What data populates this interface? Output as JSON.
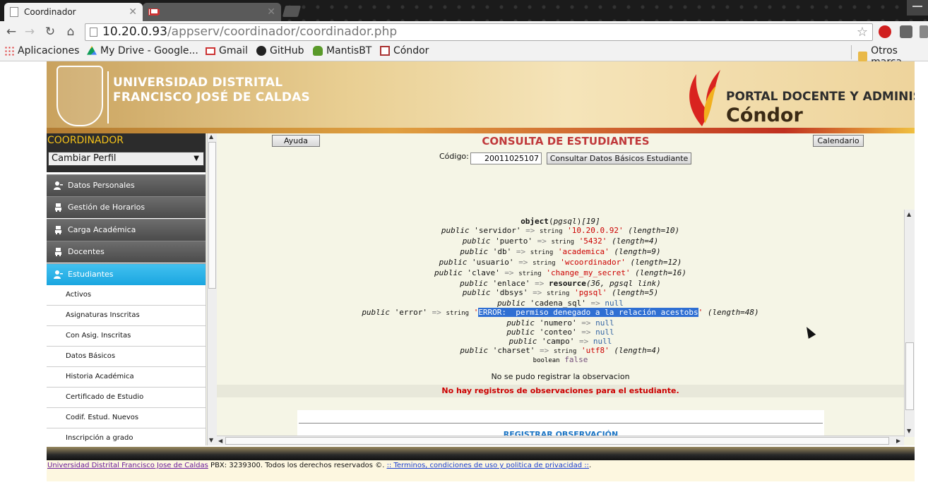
{
  "browser": {
    "tabs": [
      {
        "title": "Coordinador",
        "active": true
      },
      {
        "title": "",
        "active": false,
        "icon": "gmail-icon"
      }
    ],
    "url_host": "10.20.0.93",
    "url_path": "/appserv/coordinador/coordinador.php",
    "bookmarks": [
      {
        "label": "Aplicaciones",
        "icon": "apps-grid-icon"
      },
      {
        "label": "My Drive - Google...",
        "icon": "drive-icon"
      },
      {
        "label": "Gmail",
        "icon": "gmail-icon"
      },
      {
        "label": "GitHub",
        "icon": "github-icon"
      },
      {
        "label": "MantisBT",
        "icon": "mantis-icon"
      },
      {
        "label": "Cóndor",
        "icon": "condor-icon"
      }
    ],
    "other_bookmarks": "Otros marca"
  },
  "banner": {
    "university_line1": "UNIVERSIDAD DISTRITAL",
    "university_line2": "FRANCISCO JOSÉ DE CALDAS",
    "portal": "PORTAL DOCENTE Y ADMINISTRA",
    "condor": "Cóndor"
  },
  "sidebar": {
    "title": "COORDINADOR",
    "profile_select": "Cambiar Perfil",
    "items": [
      {
        "label": "Datos Personales",
        "icon": "user-icon"
      },
      {
        "label": "Gestión de Horarios",
        "icon": "robot-icon"
      },
      {
        "label": "Carga Académica",
        "icon": "robot-icon"
      },
      {
        "label": "Docentes",
        "icon": "robot-icon"
      },
      {
        "label": "Estudiantes",
        "icon": "user-icon",
        "active": true
      }
    ],
    "subitems": [
      "Activos",
      "Asignaturas Inscritas",
      "Con Asig. Inscritas",
      "Datos Básicos",
      "Historia Académica",
      "Certificado de Estudio",
      "Codif. Estud. Nuevos",
      "Inscripción a grado"
    ]
  },
  "content": {
    "help_button": "Ayuda",
    "calendar_button": "Calendario",
    "title": "CONSULTA DE ESTUDIANTES",
    "code_label": "Código:",
    "code_value": "20011025107",
    "consult_button": "Consultar Datos Básicos Estudiante",
    "dump": {
      "header": "object",
      "header_class": "pgsql",
      "header_id": "[19]",
      "properties": [
        {
          "name": "'servidor'",
          "type": "string",
          "value": "'10.20.0.92'",
          "length": "(length=10)"
        },
        {
          "name": "'puerto'",
          "type": "string",
          "value": "'5432'",
          "length": "(length=4)"
        },
        {
          "name": "'db'",
          "type": "string",
          "value": "'academica'",
          "length": "(length=9)"
        },
        {
          "name": "'usuario'",
          "type": "string",
          "value": "'wcoordinador'",
          "length": "(length=12)"
        },
        {
          "name": "'clave'",
          "type": "string",
          "value": "'change_my_secret'",
          "length": "(length=16)"
        },
        {
          "name": "'enlace'",
          "type": "resource",
          "value": "(36, pgsql link)",
          "length": ""
        },
        {
          "name": "'dbsys'",
          "type": "string",
          "value": "'pgsql'",
          "length": "(length=5)"
        },
        {
          "name": "'cadena_sql'",
          "type": "",
          "value": "null",
          "length": ""
        },
        {
          "name": "'error'",
          "type": "string",
          "value": "ERROR:  permiso denegado a la relación acestobs",
          "length": "(length=48)"
        },
        {
          "name": "'numero'",
          "type": "",
          "value": "null",
          "length": ""
        },
        {
          "name": "'conteo'",
          "type": "",
          "value": "null",
          "length": ""
        },
        {
          "name": "'campo'",
          "type": "",
          "value": "null",
          "length": ""
        },
        {
          "name": "'charset'",
          "type": "string",
          "value": "'utf8'",
          "length": "(length=4)"
        }
      ],
      "public_kw": "public",
      "arrow": "=>",
      "bool_type": "boolean",
      "bool_value": "false"
    },
    "no_register": "No se pudo registrar la observacion",
    "no_records": "No hay registros de observaciones para el estudiante.",
    "register_link": "REGISTRAR OBSERVACIÓN"
  },
  "footer": {
    "university_link": "Universidad Distrital Francisco Jose de Caldas",
    "contact": " PBX: 3239300. Todos los derechos reservados ©. ",
    "terms_link": ":: Terminos, condiciones de uso y politica de privacidad ::",
    "end": "."
  }
}
